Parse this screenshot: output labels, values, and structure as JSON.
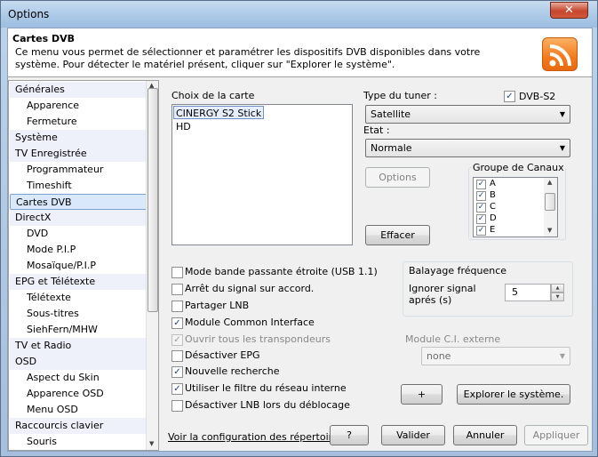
{
  "window": {
    "title": "Options",
    "close_glyph": "✕"
  },
  "header": {
    "title": "Cartes DVB",
    "description": "Ce menu vous permet de sélectionner et paramétrer les dispositifs DVB disponibles dans votre système. Pour détecter le matériel présent, cliquer sur \"Explorer le système\".",
    "icon": "rss-icon"
  },
  "sidebar": {
    "items": [
      {
        "label": "Générales",
        "level": 0
      },
      {
        "label": "Apparence",
        "level": 1
      },
      {
        "label": "Fermeture",
        "level": 1
      },
      {
        "label": "Système",
        "level": 0
      },
      {
        "label": "TV Enregistrée",
        "level": 0
      },
      {
        "label": "Programmateur",
        "level": 1
      },
      {
        "label": "Timeshift",
        "level": 1
      },
      {
        "label": "Cartes DVB",
        "level": 0,
        "selected": true
      },
      {
        "label": "DirectX",
        "level": 0
      },
      {
        "label": "DVD",
        "level": 1
      },
      {
        "label": "Mode P.I.P",
        "level": 1
      },
      {
        "label": "Mosaïque/P.I.P",
        "level": 1
      },
      {
        "label": "EPG et Télétexte",
        "level": 0
      },
      {
        "label": "Télétexte",
        "level": 1
      },
      {
        "label": "Sous-titres",
        "level": 1
      },
      {
        "label": "SiehFern/MHW",
        "level": 1
      },
      {
        "label": "TV et Radio",
        "level": 0
      },
      {
        "label": "OSD",
        "level": 0
      },
      {
        "label": "Aspect du Skin",
        "level": 1
      },
      {
        "label": "Apparence OSD",
        "level": 1
      },
      {
        "label": "Menu OSD",
        "level": 1
      },
      {
        "label": "Raccourcis clavier",
        "level": 0
      },
      {
        "label": "Souris",
        "level": 1
      }
    ]
  },
  "cards": {
    "label": "Choix de la carte",
    "items": [
      "CINERGY S2 Stick HD"
    ],
    "selected_index": 0
  },
  "tuner": {
    "type_label": "Type du tuner :",
    "type_value": "Satellite",
    "dvbs2_label": "DVB-S2",
    "dvbs2_checked": true,
    "state_label": "Etat :",
    "state_value": "Normale",
    "options_button": "Options",
    "clear_button": "Effacer"
  },
  "channel_groups": {
    "label": "Groupe de Canaux",
    "items": [
      {
        "label": "A",
        "checked": true
      },
      {
        "label": "B",
        "checked": true
      },
      {
        "label": "C",
        "checked": true
      },
      {
        "label": "D",
        "checked": true
      },
      {
        "label": "E",
        "checked": true
      }
    ]
  },
  "options": [
    {
      "label": "Mode bande passante étroite (USB 1.1)",
      "checked": false,
      "disabled": false
    },
    {
      "label": "Arrêt du signal sur accord.",
      "checked": false,
      "disabled": false
    },
    {
      "label": "Partager LNB",
      "checked": false,
      "disabled": false
    },
    {
      "label": "Module Common Interface",
      "checked": true,
      "disabled": false
    },
    {
      "label": "Ouvrir tous les transpondeurs",
      "checked": true,
      "disabled": true
    },
    {
      "label": "Désactiver EPG",
      "checked": false,
      "disabled": false
    },
    {
      "label": "Nouvelle recherche",
      "checked": true,
      "disabled": false
    },
    {
      "label": "Utiliser le filtre du réseau interne",
      "checked": true,
      "disabled": false
    },
    {
      "label": "Désactiver LNB lors du déblocage",
      "checked": false,
      "disabled": false
    }
  ],
  "scan": {
    "group_label": "Balayage fréquence",
    "ignore_label": "Ignorer signal aprés (s)",
    "ignore_value": "5"
  },
  "ci_module": {
    "label": "Module C.I. externe",
    "value": "none"
  },
  "buttons": {
    "plus": "+",
    "explore": "Explorer le système.",
    "dirs_link": "Voir la configuration des répertoires",
    "help": "?",
    "ok": "Valider",
    "cancel": "Annuler",
    "apply": "Appliquer"
  }
}
